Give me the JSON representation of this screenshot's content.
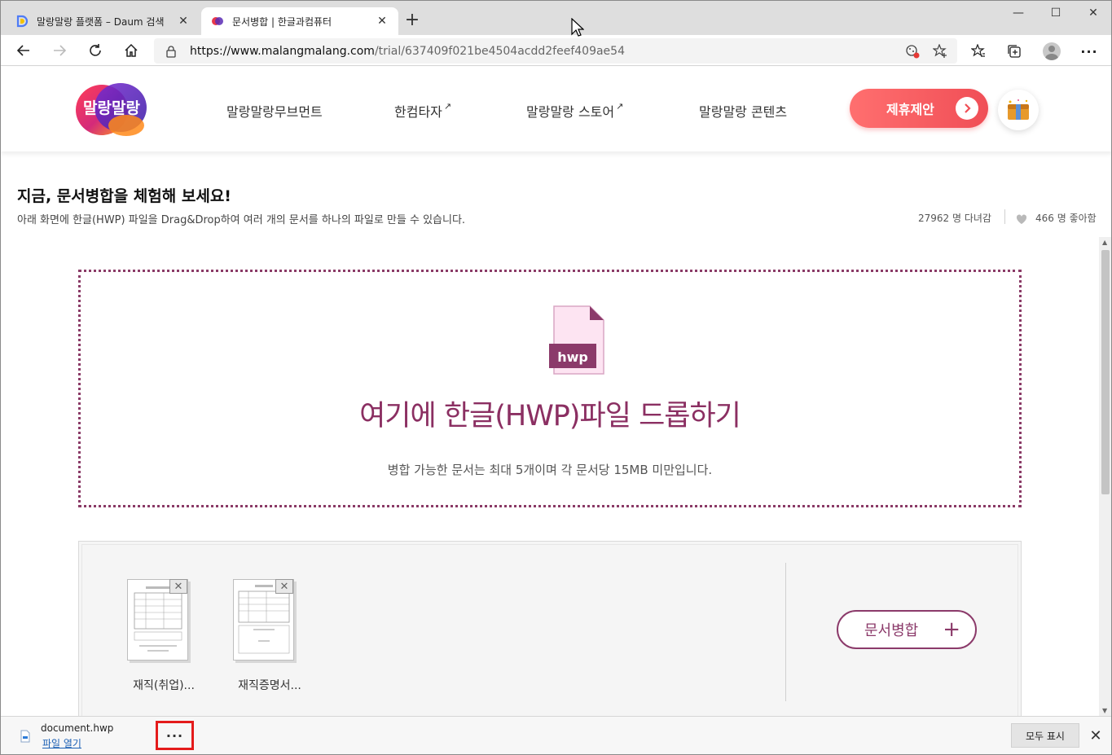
{
  "browser": {
    "tabs": [
      {
        "title": "말랑말랑 플랫폼 – Daum 검색",
        "close": "✕"
      },
      {
        "title": "문서병합 | 한글과컴퓨터",
        "close": "✕"
      }
    ],
    "new_tab": "+",
    "window_controls": {
      "minimize": "—",
      "maximize": "☐",
      "close": "✕"
    },
    "url_host": "https://www.malangmalang.com",
    "url_path": "/trial/637409f021be4504acdd2feef409ae54"
  },
  "site": {
    "logo_text": "말랑말랑",
    "nav": [
      {
        "label": "말랑말랑무브먼트",
        "external": ""
      },
      {
        "label": "한컴타자",
        "external": "↗"
      },
      {
        "label": "말랑말랑 스토어",
        "external": "↗"
      },
      {
        "label": "말랑말랑 콘텐츠",
        "external": ""
      }
    ],
    "partner_button": "제휴제안",
    "colors": {
      "accent": "#8b2f62",
      "partner": "#f04e56"
    }
  },
  "page": {
    "title": "지금, 문서병합을 체험해 보세요!",
    "subtitle": "아래 화면에 한글(HWP) 파일을 Drag&Drop하여 여러 개의 문서를 하나의 파일로 만들 수 있습니다.",
    "visitors": "27962 명 다녀감",
    "likes": "466 명 좋아함"
  },
  "dropzone": {
    "file_badge": "hwp",
    "title": "여기에 한글(HWP)파일 드롭하기",
    "note": "병합 가능한 문서는 최대 5개이며 각 문서당 15MB  미만입니다."
  },
  "files": [
    {
      "name": "재직(취업)...",
      "remove": "✕"
    },
    {
      "name": "재직증명서...",
      "remove": "✕"
    }
  ],
  "merge_button": {
    "label": "문서병합",
    "plus": "+"
  },
  "downloads": {
    "file_name": "document.hwp",
    "open_label": "파일 열기",
    "more": "···",
    "show_all": "모두 표시",
    "close": "✕"
  }
}
